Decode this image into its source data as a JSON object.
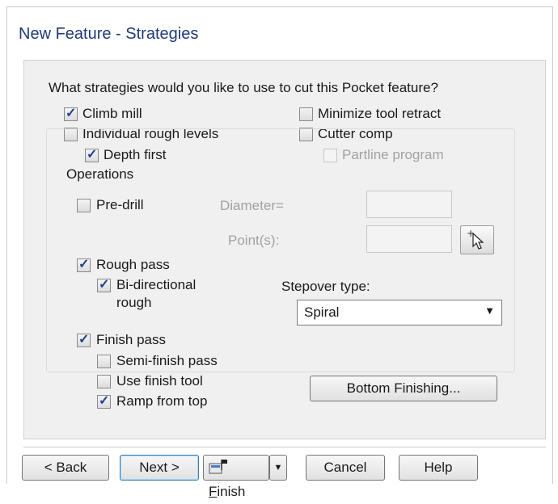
{
  "window": {
    "title": "New Feature - Strategies"
  },
  "question": "What strategies would you like to use to cut this Pocket feature?",
  "strategies": {
    "climb_mill": {
      "label": "Climb mill",
      "checked": true
    },
    "individual_rough_levels": {
      "label": "Individual rough levels",
      "checked": false
    },
    "depth_first": {
      "label": "Depth first",
      "checked": true
    },
    "minimize_tool_retract": {
      "label": "Minimize tool retract",
      "checked": false
    },
    "cutter_comp": {
      "label": "Cutter comp",
      "checked": false
    },
    "partline_program": {
      "label": "Partline program",
      "checked": false,
      "disabled": true
    }
  },
  "operations": {
    "label": "Operations",
    "pre_drill": {
      "label": "Pre-drill",
      "checked": false
    },
    "diameter_label": "Diameter=",
    "diameter_value": "",
    "points_label": "Point(s):",
    "points_value": "",
    "rough_pass": {
      "label": "Rough pass",
      "checked": true
    },
    "bidirectional": {
      "label_line1": "Bi-directional",
      "label_line2": "rough",
      "checked": true
    },
    "stepover": {
      "label": "Stepover type:",
      "value": "Spiral"
    },
    "finish_pass": {
      "label": "Finish pass",
      "checked": true
    },
    "semi_finish": {
      "label": "Semi-finish pass",
      "checked": false
    },
    "use_finish_tool": {
      "label": "Use finish tool",
      "checked": false
    },
    "ramp_from_top": {
      "label": "Ramp from top",
      "checked": true
    },
    "bottom_finishing": "Bottom Finishing..."
  },
  "buttons": {
    "back": "< Back",
    "next": "Next >",
    "finish_rest": "inish",
    "finish_mnemonic": "F",
    "cancel": "Cancel",
    "help": "Help"
  },
  "colors": {
    "title": "#1f3b78",
    "check": "#1e3f8f",
    "disabled_text": "#a2a2a2"
  }
}
